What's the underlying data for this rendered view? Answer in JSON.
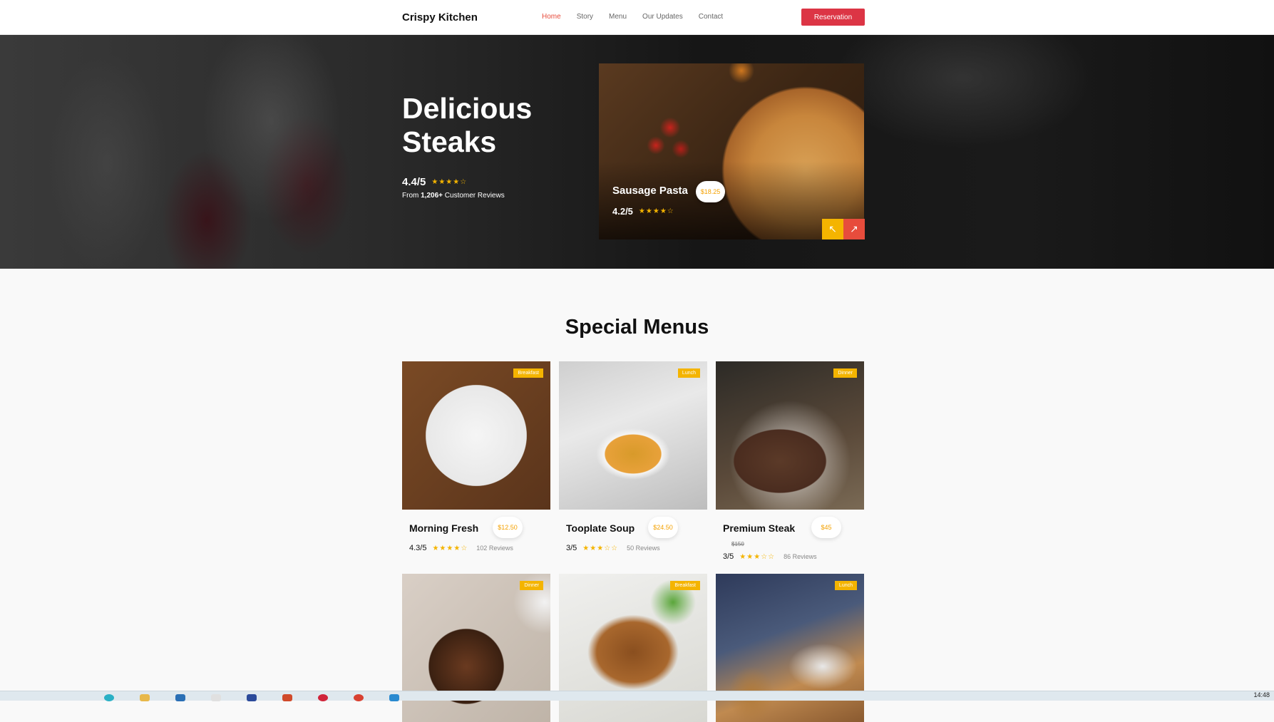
{
  "nav": {
    "brand": "Crispy Kitchen",
    "links": [
      "Home",
      "Story",
      "Menu",
      "Our Updates",
      "Contact"
    ],
    "cta": "Reservation"
  },
  "hero": {
    "title": "Delicious Steaks",
    "rating": "4.4/5",
    "stars": "★★★★☆",
    "reviews_prefix": "From",
    "reviews_count": "1,206+",
    "reviews_suffix": "Customer Reviews",
    "feature": {
      "name": "Sausage Pasta",
      "price": "$18.25",
      "rating": "4.2/5",
      "stars": "★★★★☆"
    },
    "prev_icon": "↖",
    "next_icon": "↗"
  },
  "special": {
    "title": "Special Menus",
    "items": [
      {
        "name": "Morning Fresh",
        "price": "$12.50",
        "badge": "Breakfast",
        "rating": "4.3/5",
        "stars": "★★★★☆",
        "reviews": "102 Reviews"
      },
      {
        "name": "Tooplate Soup",
        "price": "$24.50",
        "badge": "Lunch",
        "rating": "3/5",
        "stars": "★★★☆☆",
        "reviews": "50 Reviews"
      },
      {
        "name": "Premium Steak",
        "price": "$45",
        "old_price": "$150",
        "badge": "Dinner",
        "rating": "3/5",
        "stars": "★★★☆☆",
        "reviews": "86 Reviews"
      },
      {
        "badge": "Dinner"
      },
      {
        "badge": "Breakfast"
      },
      {
        "badge": "Lunch"
      }
    ]
  },
  "taskbar": {
    "clock": "14:48"
  },
  "colors": {
    "accent": "#dc3545",
    "star": "#f4b400",
    "price": "#f4a100"
  }
}
